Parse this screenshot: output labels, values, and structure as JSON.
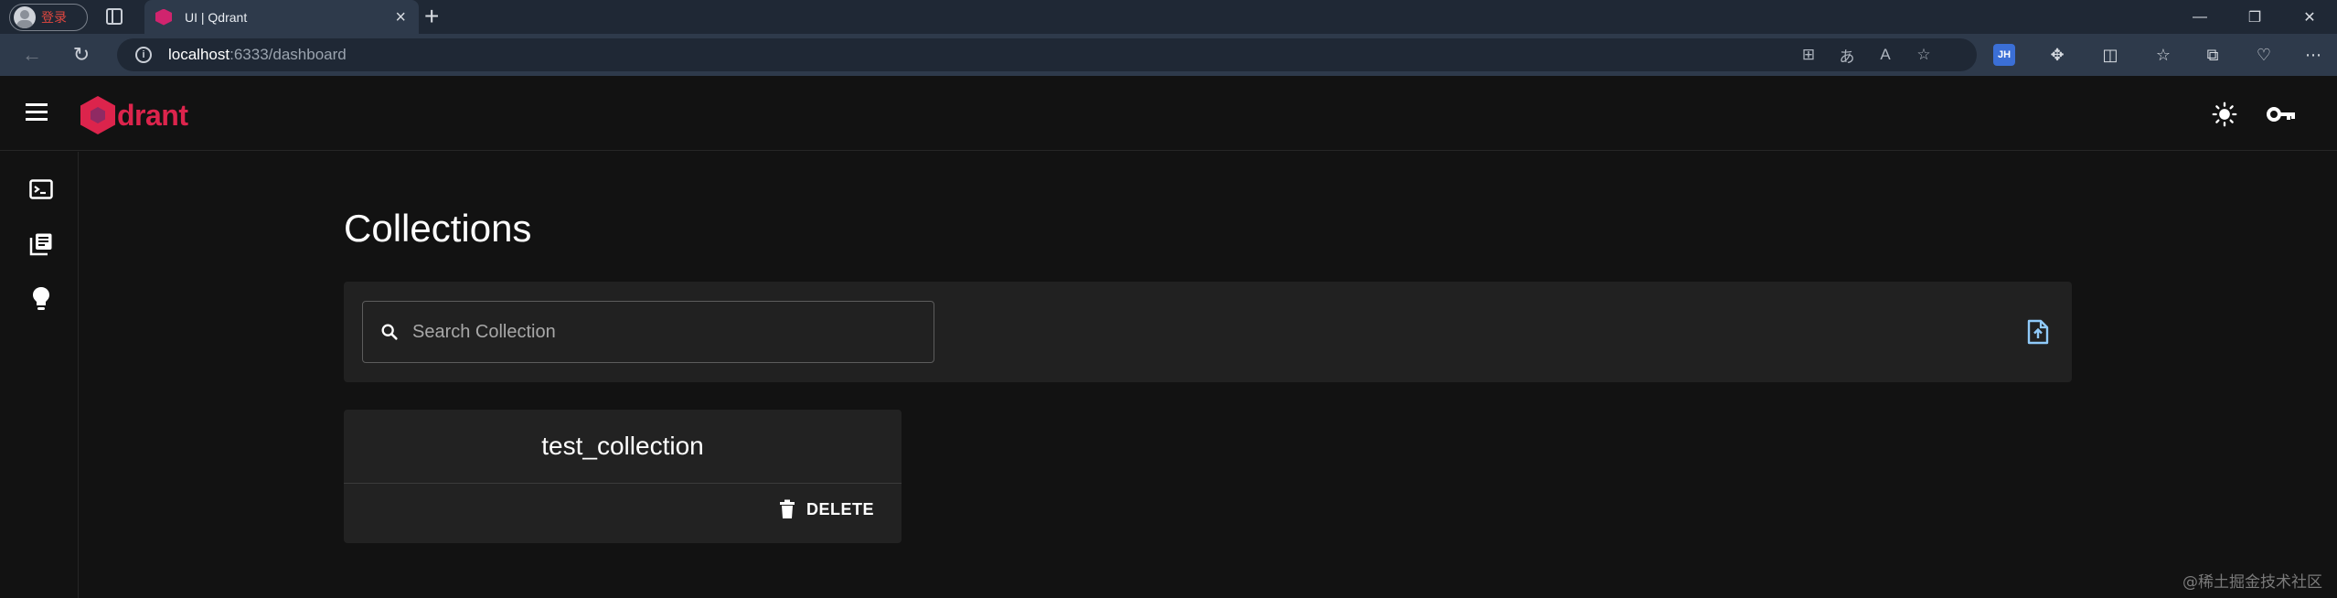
{
  "browser": {
    "profile_label": "登录",
    "tab_title": "UI | Qdrant",
    "url_host": "localhost",
    "url_rest": ":6333/dashboard"
  },
  "app": {
    "brand": "drant",
    "page_title": "Collections",
    "search": {
      "placeholder": "Search Collection",
      "value": ""
    },
    "collections": [
      {
        "name": "test_collection",
        "action_label": "DELETE"
      }
    ]
  },
  "watermark": "@稀土掘金技术社区",
  "colors": {
    "brand": "#dc244c",
    "accent": "#90caf9",
    "background": "#121212",
    "panel": "#212121"
  }
}
